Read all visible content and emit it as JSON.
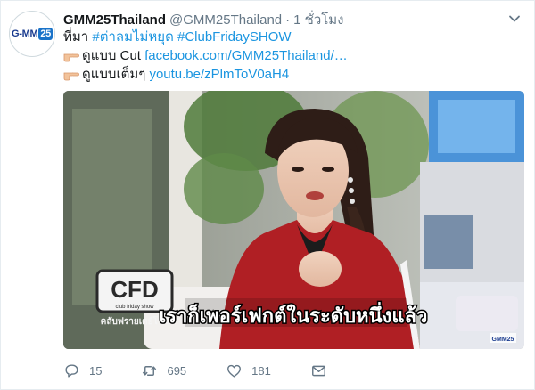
{
  "tweet": {
    "display_name": "GMM25Thailand",
    "handle": "@GMM25Thailand",
    "separator": "·",
    "time": "1 ชั่วโมง",
    "line1_prefix": "ที่มา",
    "line1_hashtag1": "#ต่าลมไม่หยุด",
    "line1_hashtag2": "#ClubFridaySHOW",
    "line2_prefix": "ดูแบบ Cut",
    "line2_link": "facebook.com/GMM25Thailand/…",
    "line3_prefix": "ดูแบบเต็มๆ",
    "line3_link": "youtu.be/zPlmToV0aH4"
  },
  "avatar": {
    "logo_text": "G-MM",
    "logo_number": "25"
  },
  "video": {
    "caption": "เราก็เพอร์เฟกต์ในระดับหนึ่งแล้ว",
    "show_logo": "CFD",
    "show_logo_sub": "club friday show",
    "show_logo_under": "คลับฟรายเดย์โชว์",
    "channel_tag": "GMM25"
  },
  "actions": {
    "reply_count": "15",
    "retweet_count": "695",
    "like_count": "181"
  },
  "colors": {
    "link": "#1b95e0",
    "muted": "#657786",
    "text": "#14171a",
    "blazer": "#b01f24"
  },
  "icons": [
    "chevron-down-icon",
    "pointing-hand-icon",
    "reply-icon",
    "retweet-icon",
    "heart-icon",
    "envelope-icon"
  ]
}
